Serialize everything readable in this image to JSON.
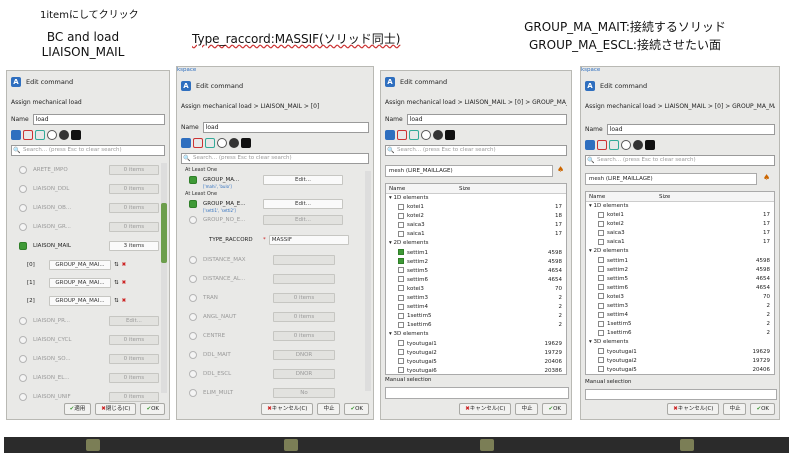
{
  "annotations": {
    "a1": "1itemにしてクリック",
    "a2": "BC and load",
    "a3": "LIAISON_MAIL",
    "a4": "Type_raccord:MASSIF(ソリッド同士)",
    "a5": "GROUP_MA_MAIT:接続するソリッド",
    "a6": "GROUP_MA_ESCL:接続させたい面"
  },
  "common": {
    "edit_command": "Edit command",
    "name_label": "Name",
    "name_value": "load",
    "search_placeholder": "Search... (press Esc to clear search)",
    "ok": "OK",
    "cancel": "キャンセル(C)",
    "abort": "中止",
    "apply": "適用",
    "close": "閉じる(C)",
    "kspace": "kspace"
  },
  "panel1": {
    "breadcrumb": "Assign mechanical load",
    "rows": [
      {
        "label": "ARETE_IMPO",
        "value": "0 items"
      },
      {
        "label": "LIAISON_DDL",
        "value": "0 items"
      },
      {
        "label": "LIAISON_OB...",
        "value": "0 items"
      },
      {
        "label": "LIAISON_GR...",
        "value": "0 items"
      },
      {
        "label": "LIAISON_MAIL",
        "value": "3 items"
      },
      {
        "label": "LIAISON_PR...",
        "value": "Edit..."
      },
      {
        "label": "LIAISON_CYCL",
        "value": "0 items"
      },
      {
        "label": "LIAISON_SO...",
        "value": "0 items"
      },
      {
        "label": "LIAISON_EL...",
        "value": "0 items"
      },
      {
        "label": "LIAISON_UNIF",
        "value": "0 items"
      }
    ],
    "sub": [
      {
        "idx": "[0]",
        "value": "GROUP_MA_MAI..."
      },
      {
        "idx": "[1]",
        "value": "GROUP_MA_MAI..."
      },
      {
        "idx": "[2]",
        "value": "GROUP_MA_MAI..."
      }
    ]
  },
  "panel2": {
    "breadcrumb": "Assign mechanical load > LIAISON_MAIL > [0]",
    "atleast": "At Least One",
    "g1": "GROUP_MA...",
    "g1sub": "['mahi', 'bulo']",
    "g2": "GROUP_MA_E...",
    "g2sub": "['setti1', 'setti2']",
    "edit": "Edit...",
    "group_no_e": "GROUP_NO_E...",
    "type_raccord": "TYPE_RACCORD",
    "massif": "MASSIF",
    "rows": [
      {
        "label": "DISTANCE_MAX"
      },
      {
        "label": "DISTANCE_AL..."
      },
      {
        "label": "TRAN",
        "value": "0 items"
      },
      {
        "label": "ANGL_NAUT",
        "value": "0 items"
      },
      {
        "label": "CENTRE",
        "value": "0 items"
      },
      {
        "label": "DDL_MAIT",
        "value": "DNOR"
      },
      {
        "label": "DDL_ESCL",
        "value": "DNOR"
      },
      {
        "label": "ELIM_MULT",
        "value": "No"
      }
    ]
  },
  "panel3": {
    "breadcrumb": "Assign mechanical load > LIAISON_MAIL > [0] > GROUP_MA_ESCL",
    "mesh": "mesh (LIRE_MAILLAGE)",
    "col_name": "Name",
    "col_size": "Size",
    "manual": "Manual selection",
    "tree": [
      {
        "t": "g",
        "name": "1D elements"
      },
      {
        "t": "i",
        "name": "kotei1",
        "size": "17"
      },
      {
        "t": "i",
        "name": "kotei2",
        "size": "18"
      },
      {
        "t": "i",
        "name": "saica3",
        "size": "17"
      },
      {
        "t": "i",
        "name": "saica1",
        "size": "17"
      },
      {
        "t": "g",
        "name": "2D elements"
      },
      {
        "t": "i",
        "name": "settim1",
        "size": "4598",
        "c": true
      },
      {
        "t": "i",
        "name": "settim2",
        "size": "4598",
        "c": true
      },
      {
        "t": "i",
        "name": "settim5",
        "size": "4654"
      },
      {
        "t": "i",
        "name": "settim6",
        "size": "4654"
      },
      {
        "t": "i",
        "name": "kotei3",
        "size": "70"
      },
      {
        "t": "i",
        "name": "settim3",
        "size": "2"
      },
      {
        "t": "i",
        "name": "settim4",
        "size": "2"
      },
      {
        "t": "i",
        "name": "1settim5",
        "size": "2"
      },
      {
        "t": "i",
        "name": "1settim6",
        "size": "2"
      },
      {
        "t": "g",
        "name": "3D elements"
      },
      {
        "t": "i",
        "name": "tyoutugai1",
        "size": "19629"
      },
      {
        "t": "i",
        "name": "tyoutugai2",
        "size": "19729"
      },
      {
        "t": "i",
        "name": "tyoutugai5",
        "size": "20406"
      },
      {
        "t": "i",
        "name": "tyoutugai6",
        "size": "20386"
      }
    ]
  },
  "panel4": {
    "breadcrumb": "Assign mechanical load > LIAISON_MAIL > [0] > GROUP_MA_MAIT",
    "tree": [
      {
        "t": "g",
        "name": "1D elements"
      },
      {
        "t": "i",
        "name": "kotei1",
        "size": "17"
      },
      {
        "t": "i",
        "name": "kotei2",
        "size": "17"
      },
      {
        "t": "i",
        "name": "saica3",
        "size": "17"
      },
      {
        "t": "i",
        "name": "saica1",
        "size": "17"
      },
      {
        "t": "g",
        "name": "2D elements"
      },
      {
        "t": "i",
        "name": "settim1",
        "size": "4598"
      },
      {
        "t": "i",
        "name": "settim2",
        "size": "4598"
      },
      {
        "t": "i",
        "name": "settim5",
        "size": "4654"
      },
      {
        "t": "i",
        "name": "settim6",
        "size": "4654"
      },
      {
        "t": "i",
        "name": "kotei3",
        "size": "70"
      },
      {
        "t": "i",
        "name": "settim3",
        "size": "2"
      },
      {
        "t": "i",
        "name": "settim4",
        "size": "2"
      },
      {
        "t": "i",
        "name": "1settim5",
        "size": "2"
      },
      {
        "t": "i",
        "name": "1settim6",
        "size": "2"
      },
      {
        "t": "g",
        "name": "3D elements"
      },
      {
        "t": "i",
        "name": "tyoutugai1",
        "size": "19629"
      },
      {
        "t": "i",
        "name": "tyoutugai2",
        "size": "19729"
      },
      {
        "t": "i",
        "name": "tyoutugai5",
        "size": "20406"
      },
      {
        "t": "i",
        "name": "tyoutugai6",
        "size": "20386"
      }
    ]
  }
}
